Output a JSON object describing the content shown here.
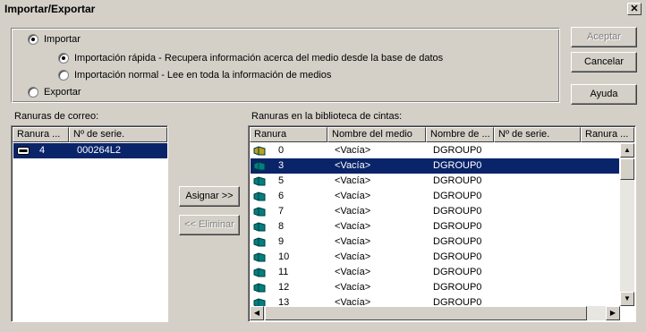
{
  "window": {
    "title": "Importar/Exportar",
    "close_glyph": "✕"
  },
  "options": {
    "import_label": "Importar",
    "quick_import_label": "Importación rápida - Recupera información acerca del medio desde la base de datos",
    "normal_import_label": "Importación normal - Lee en toda la información de medios",
    "export_label": "Exportar",
    "selected": "quick_import"
  },
  "buttons": {
    "accept": "Aceptar",
    "cancel": "Cancelar",
    "help": "Ayuda",
    "assign": "Asignar >>",
    "remove": "<< Eliminar"
  },
  "mail_slots": {
    "label": "Ranuras de correo:",
    "columns": [
      "Ranura ...",
      "Nº de serie."
    ],
    "rows": [
      {
        "slot": "4",
        "serial": "000264L2",
        "icon": "mail-slot-icon"
      }
    ]
  },
  "library_slots": {
    "label": "Ranuras en la biblioteca de cintas:",
    "columns": [
      "Ranura",
      "Nombre del medio",
      "Nombre de ...",
      "Nº de serie.",
      "Ranura ..."
    ],
    "rows": [
      {
        "slot": "0",
        "media": "<Vacía>",
        "group": "DGROUP0",
        "icon_color": "#b8a020"
      },
      {
        "slot": "3",
        "media": "<Vacía>",
        "group": "DGROUP0",
        "icon_color": "#008080",
        "selected": true
      },
      {
        "slot": "5",
        "media": "<Vacía>",
        "group": "DGROUP0",
        "icon_color": "#008080"
      },
      {
        "slot": "6",
        "media": "<Vacía>",
        "group": "DGROUP0",
        "icon_color": "#008080"
      },
      {
        "slot": "7",
        "media": "<Vacía>",
        "group": "DGROUP0",
        "icon_color": "#008080"
      },
      {
        "slot": "8",
        "media": "<Vacía>",
        "group": "DGROUP0",
        "icon_color": "#008080"
      },
      {
        "slot": "9",
        "media": "<Vacía>",
        "group": "DGROUP0",
        "icon_color": "#008080"
      },
      {
        "slot": "10",
        "media": "<Vacía>",
        "group": "DGROUP0",
        "icon_color": "#008080"
      },
      {
        "slot": "11",
        "media": "<Vacía>",
        "group": "DGROUP0",
        "icon_color": "#008080"
      },
      {
        "slot": "12",
        "media": "<Vacía>",
        "group": "DGROUP0",
        "icon_color": "#008080"
      },
      {
        "slot": "13",
        "media": "<Vacía>",
        "group": "DGROUP0",
        "icon_color": "#008080"
      }
    ]
  },
  "colors": {
    "selection": "#0a246a",
    "face": "#d4d0c8"
  }
}
